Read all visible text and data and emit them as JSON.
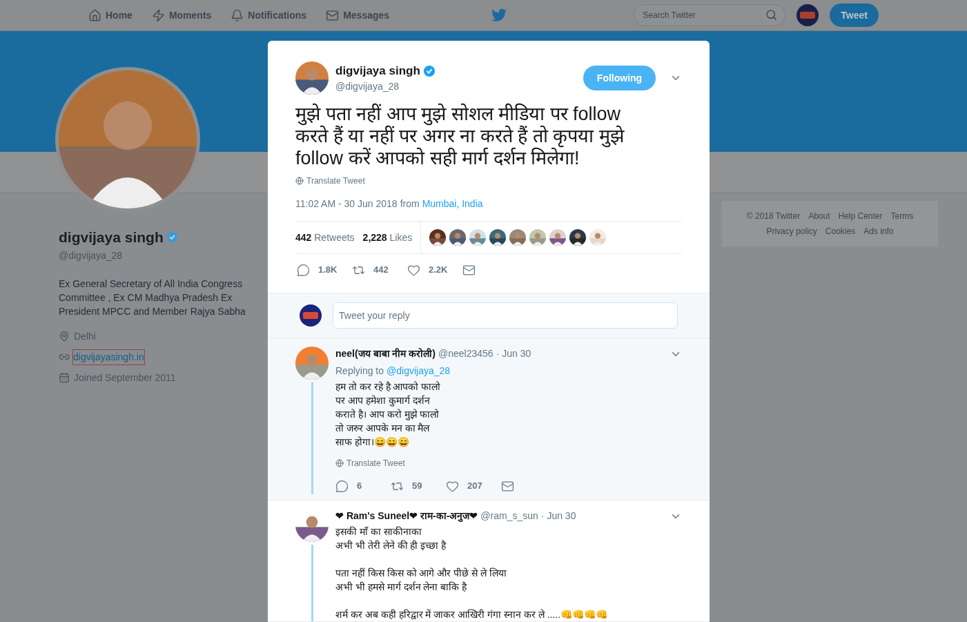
{
  "nav": {
    "items": [
      {
        "label": "Home"
      },
      {
        "label": "Moments"
      },
      {
        "label": "Notifications"
      },
      {
        "label": "Messages"
      }
    ],
    "search": {
      "placeholder": "Search Twitter"
    },
    "tweet_button": "Tweet"
  },
  "profile": {
    "name": "digvijaya singh",
    "verified": true,
    "handle": "@digvijaya_28",
    "bio": "Ex General Secretary of All India Congress Committee , Ex CM Madhya Pradesh Ex President MPCC and Member Rajya Sabha",
    "location": "Delhi",
    "website": "digvijayasingh.in",
    "joined": "Joined September 2011"
  },
  "footer": {
    "links": [
      "© 2018 Twitter",
      "About",
      "Help Center",
      "Terms",
      "Privacy policy",
      "Cookies",
      "Ads info"
    ]
  },
  "tweet": {
    "name": "digvijaya singh",
    "verified": true,
    "handle": "@digvijaya_28",
    "follow_button": "Following",
    "text": "मुझे पता नहीं आप मुझे सोशल मीडिया पर follow करते हैं या नहीं पर अगर ना करते हैं तो कृपया मुझे follow करें आपको सही मार्ग दर्शन मिलेगा!",
    "translate": "Translate Tweet",
    "time": "11:02 AM - 30 Jun 2018",
    "from": "from",
    "place": "Mumbai, India",
    "stats": [
      {
        "count": "442",
        "label": "Retweets"
      },
      {
        "count": "2,228",
        "label": "Likes"
      }
    ],
    "actions": [
      {
        "kind": "reply",
        "count": "1.8K"
      },
      {
        "kind": "retweet",
        "count": "442"
      },
      {
        "kind": "like",
        "count": "2.2K"
      },
      {
        "kind": "dm"
      }
    ]
  },
  "reply_box": {
    "placeholder": "Tweet your reply"
  },
  "replies": [
    {
      "name": "neel(जय बाबा नीम करोली)",
      "handle": "@neel23456",
      "date": "· Jun 30",
      "replying_label": "Replying to",
      "replying_to": "@digvijaya_28",
      "paragraphs": [
        [
          "हम तो कर रहे है आपको फालो",
          "पर आप हमेशा कुमार्ग दर्शन",
          "कराते है। आप करो मुझे फालो",
          "तो जरुर आपके मन का मैल",
          "साफ होगा।😄😄😄"
        ]
      ],
      "translate": "Translate Tweet",
      "actions": [
        {
          "kind": "reply",
          "count": "6"
        },
        {
          "kind": "retweet",
          "count": "59"
        },
        {
          "kind": "like",
          "count": "207"
        },
        {
          "kind": "dm"
        }
      ]
    },
    {
      "name": "❤ Ram's Suneel❤ राम-का-अनुज❤",
      "handle": "@ram_s_sun",
      "date": "· Jun 30",
      "paragraphs": [
        [
          "इसकी माँ का साकीनाका",
          "अभी भी तेरी लेने की ही इच्छा है"
        ],
        [
          "पता नहीं किस किस को आगे और पीछे से ले लिया",
          "अभी भी हमसे मार्ग दर्शन लेना बाकि है"
        ],
        [
          "शर्म कर अब कही हरिद्वार में जाकर आखिरी गंगा स्नान कर ले .....👊👊👊👊"
        ]
      ]
    }
  ]
}
